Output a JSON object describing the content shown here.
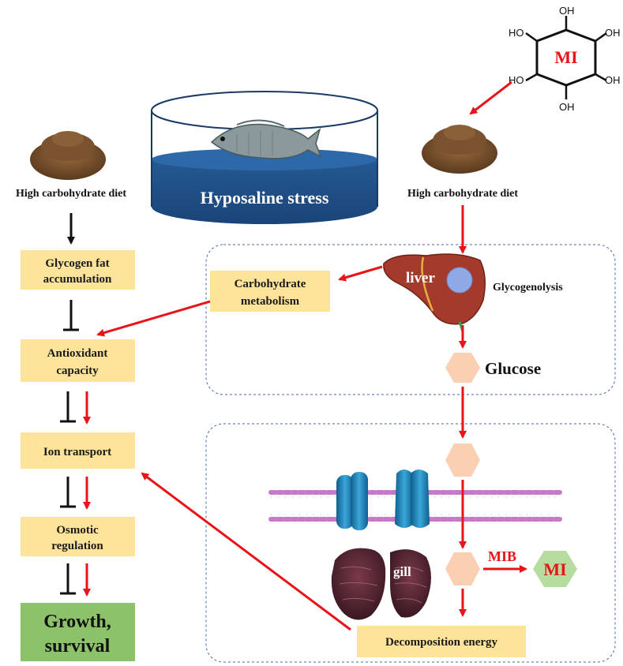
{
  "labels": {
    "hyposaline_stress": "Hyposaline stress",
    "left_diet": "High carbohydrate diet",
    "right_diet": "High carbohydrate diet",
    "mi_molecule": "MI",
    "liver": "liver",
    "glycogenolysis": "Glycogenolysis",
    "glucose": "Glucose",
    "gill": "gill",
    "mib": "MIB",
    "mi_product": "MI",
    "hydroxyl": "HO",
    "hydroxyl_right": "OH"
  },
  "left_column": {
    "glycogen_line1": "Glycogen  fat",
    "glycogen_line2": "accumulation",
    "antioxidant_line1": "Antioxidant",
    "antioxidant_line2": "capacity",
    "ion_transport": "Ion transport",
    "osmotic_line1": "Osmotic",
    "osmotic_line2": "regulation",
    "growth_line1": "Growth,",
    "growth_line2": "survival"
  },
  "right_panel": {
    "carb_line1": "Carbohydrate",
    "carb_line2": "metabolism",
    "decomposition": "Decomposition energy"
  },
  "colors": {
    "red_arrow": "#e8141a",
    "yellow_box": "#fde49a",
    "green_box": "#8cc36a",
    "hexagon": "#fbcfb2",
    "mi_hexagon": "#b6dca0",
    "tank_blue": "#21558f",
    "liver": "#a33a2c",
    "membrane": "#c778c9",
    "dashed_border": "#4a6aa8"
  }
}
